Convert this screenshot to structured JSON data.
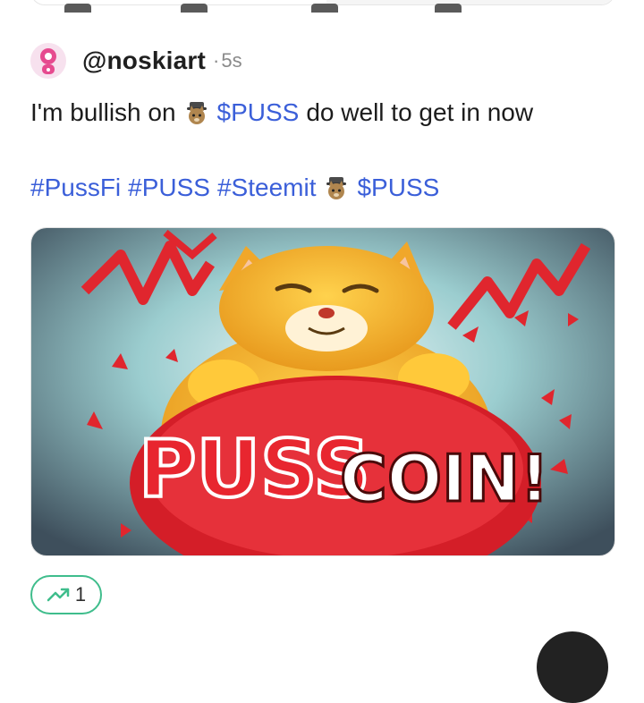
{
  "post": {
    "username": "@noskiart",
    "separator": "·",
    "time": "5s",
    "line1": {
      "before": "I'm bullish on",
      "ticker": "$PUSS",
      "after": "do well to get in now"
    },
    "hashtags": [
      "#PussFi",
      "#PUSS",
      "#Steemit"
    ],
    "ticker2": "$PUSS",
    "image": {
      "text_left": "PUSS",
      "text_right": "COIN!"
    },
    "vote_count": "1"
  },
  "colors": {
    "link": "#3b5fd9",
    "vote_border": "#3fbd8c",
    "text": "#1c1c1c",
    "muted": "#8a8a8a"
  },
  "icons": [
    "avatar-icon",
    "cat-detective-emoji-icon",
    "trending-up-icon"
  ]
}
